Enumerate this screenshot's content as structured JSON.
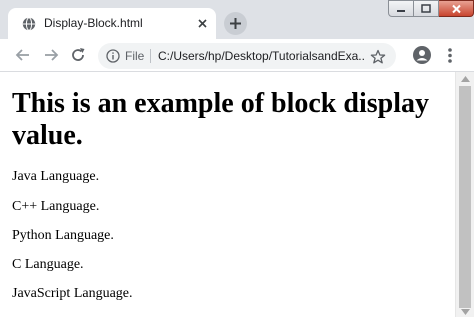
{
  "tab": {
    "title": "Display-Block.html"
  },
  "toolbar": {
    "scheme_label": "File",
    "url": "C:/Users/hp/Desktop/TutorialsandExa..."
  },
  "icons": {
    "favicon": "globe-icon",
    "tab_close": "close-icon",
    "new_tab": "plus-icon",
    "back": "back-arrow-icon",
    "forward": "forward-arrow-icon",
    "reload": "reload-icon",
    "info": "info-icon",
    "bookmark": "star-icon",
    "account": "account-icon",
    "menu": "kebab-menu-icon"
  },
  "page": {
    "heading": "This is an example of block display value.",
    "items": [
      "Java Language.",
      "C++ Language.",
      "Python Language.",
      "C Language.",
      "JavaScript Language."
    ]
  },
  "colors": {
    "tabstrip": "#dee1e6",
    "omnibox": "#f1f3f4",
    "close_button": "#c8452f"
  }
}
